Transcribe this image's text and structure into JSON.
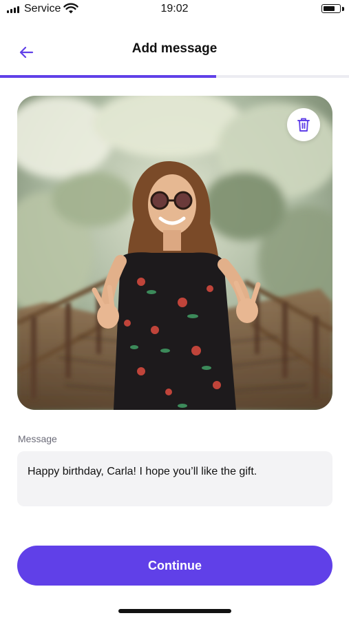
{
  "status_bar": {
    "carrier": "Service",
    "time": "19:02",
    "battery_level": 0.75,
    "icons": [
      "signal-icon",
      "wifi-icon",
      "battery-icon"
    ]
  },
  "header": {
    "title": "Add message",
    "back_icon": "arrow-left-icon"
  },
  "progress": {
    "fraction": 0.62
  },
  "photo": {
    "delete_icon": "trash-icon"
  },
  "message": {
    "label": "Message",
    "value": "Happy birthday, Carla! I hope you’ll like the gift."
  },
  "actions": {
    "continue_label": "Continue"
  },
  "colors": {
    "accent": "#6040e8",
    "field_bg": "#f3f3f5",
    "label_text": "#6b6b78"
  }
}
